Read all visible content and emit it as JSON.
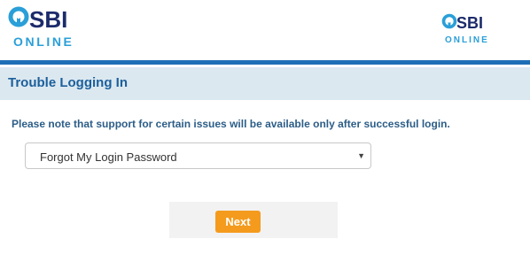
{
  "header": {
    "logo_left": {
      "brand": "SBI",
      "sub": "ONLINE"
    },
    "logo_right": {
      "brand": "SBI",
      "sub": "ONLINE"
    }
  },
  "section": {
    "title": "Trouble Logging In"
  },
  "notice": "Please note that support for certain issues will be available only after successful login.",
  "issue_select": {
    "selected": "Forgot My Login Password"
  },
  "next_label": "Next",
  "colors": {
    "brand_blue": "#2a9fd8",
    "brand_navy": "#1c2b6b",
    "header_bar": "#1f6fb7",
    "band_bg": "#dbe8f0",
    "title_text": "#1c5f9b",
    "button_orange": "#f49b1d"
  }
}
